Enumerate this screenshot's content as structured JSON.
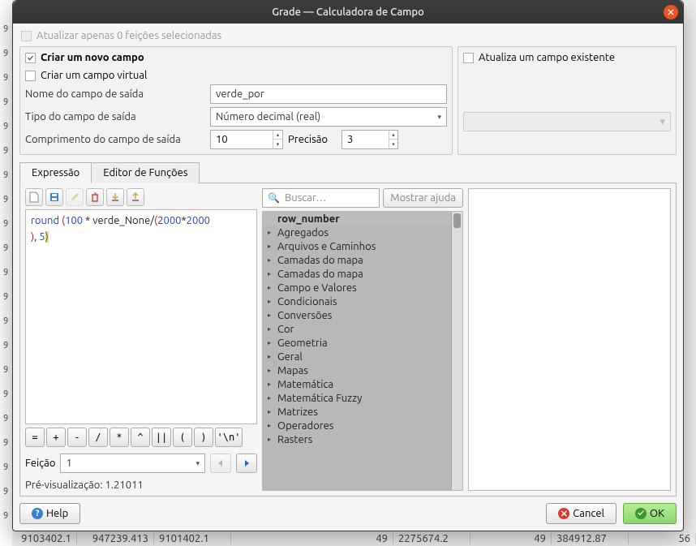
{
  "window": {
    "title": "Grade — Calculadora de Campo"
  },
  "top": {
    "update_selected": "Atualizar apenas 0 feições selecionadas"
  },
  "left_panel": {
    "create_new": "Criar um novo campo",
    "create_virtual": "Criar um campo virtual",
    "lbl_name": "Nome do campo de saída",
    "val_name": "verde_por",
    "lbl_type": "Tipo do campo de saída",
    "val_type": "Número decimal (real)",
    "lbl_length": "Comprimento do campo de saída",
    "val_length": "10",
    "lbl_precision": "Precisão",
    "val_precision": "3"
  },
  "right_panel": {
    "update_existing": "Atualiza um campo existente"
  },
  "tabs": {
    "expr": "Expressão",
    "funcs": "Editor de Funções"
  },
  "toolbar_icons": [
    "new",
    "save",
    "edit",
    "delete",
    "import",
    "export"
  ],
  "expr": {
    "t1": "round ",
    "t2": "(",
    "t3": "100",
    "t4": " * verde_None/",
    "t5": "(",
    "t6": "2000",
    "t7": "*",
    "t8": "2000",
    "t9": ")",
    "t10": ", ",
    "t11": "5",
    "t12": ")"
  },
  "ops": [
    "=",
    "+",
    "-",
    "/",
    "*",
    "^",
    "||",
    "(",
    ")",
    "'\\n'"
  ],
  "feature": {
    "label": "Feição",
    "value": "1"
  },
  "preview": {
    "label": "Pré-visualização: ",
    "value": "1.21011"
  },
  "search": {
    "placeholder": "Buscar…",
    "help": "Mostrar ajuda"
  },
  "tree": [
    {
      "label": "row_number",
      "head": true
    },
    {
      "label": "Agregados"
    },
    {
      "label": "Arquivos e Caminhos"
    },
    {
      "label": "Camadas do mapa"
    },
    {
      "label": "Camadas do mapa"
    },
    {
      "label": "Campo e Valores"
    },
    {
      "label": "Condicionais"
    },
    {
      "label": "Conversões"
    },
    {
      "label": "Cor"
    },
    {
      "label": "Geometria"
    },
    {
      "label": "Geral"
    },
    {
      "label": "Mapas"
    },
    {
      "label": "Matemática"
    },
    {
      "label": "Matemática Fuzzy"
    },
    {
      "label": "Matrizes"
    },
    {
      "label": "Operadores"
    },
    {
      "label": "Rasters"
    }
  ],
  "footer": {
    "help": "Help",
    "cancel": "Cancel",
    "ok": "OK"
  },
  "bg": {
    "c1": "9103402.1",
    "c2": "947239.413",
    "c3": "9101402.1",
    "c4": "49",
    "c5": "2275674.2",
    "c6": "49",
    "c7": "384912.87",
    "c8": "56"
  }
}
